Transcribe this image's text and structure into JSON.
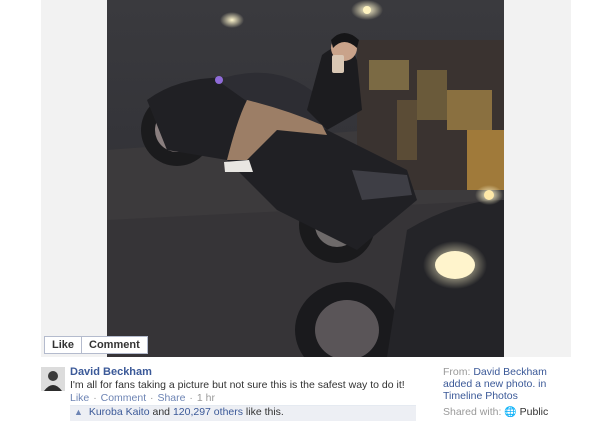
{
  "photo": {
    "alt_subject": "motorcycle-night-selfie"
  },
  "photo_actions": {
    "like_label": "Like",
    "comment_label": "Comment"
  },
  "post": {
    "author": "David Beckham",
    "message": "I'm all for fans taking a picture but not sure this is the safest way to do it!",
    "actions": {
      "like": "Like",
      "comment": "Comment",
      "share": "Share",
      "separator": "·",
      "time": "1 hr"
    },
    "likes": {
      "first_name": "Kuroba Kaito",
      "joiner": "and",
      "others": "120,297 others",
      "suffix": "like this."
    }
  },
  "sidebar": {
    "from_label": "From:",
    "from_name": "David Beckham",
    "added_text": "added a new photo.",
    "in_text": "in",
    "album": "Timeline Photos",
    "shared_label": "Shared with:",
    "audience": "Public",
    "globe_icon": "globe-icon"
  },
  "colors": {
    "link": "#3b5998",
    "muted": "#999999",
    "likes_bg": "#edeff4"
  }
}
